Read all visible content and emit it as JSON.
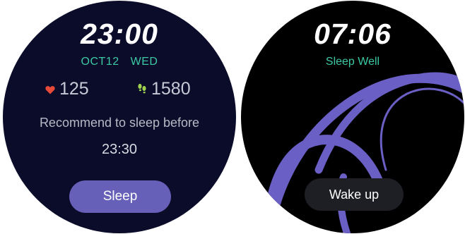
{
  "left_watch": {
    "time": "23:00",
    "date": "OCT12",
    "weekday": "WED",
    "heart_rate": "125",
    "steps": "1580",
    "recommend_text": "Recommend to sleep before",
    "recommend_time": "23:30",
    "sleep_button_label": "Sleep",
    "icons": {
      "heart": "heart-icon",
      "steps": "footsteps-icon"
    },
    "colors": {
      "background": "#0a0c29",
      "accent": "#3cc9a4",
      "heart": "#e84a3a",
      "steps": "#9fd24e",
      "button": "#6660b8"
    }
  },
  "right_watch": {
    "time": "07:06",
    "subtitle": "Sleep Well",
    "wake_button_label": "Wake up",
    "colors": {
      "background": "#000000",
      "accent": "#3cc9a4",
      "arcs": "#6a5fc4",
      "button": "#1e1f24"
    }
  }
}
